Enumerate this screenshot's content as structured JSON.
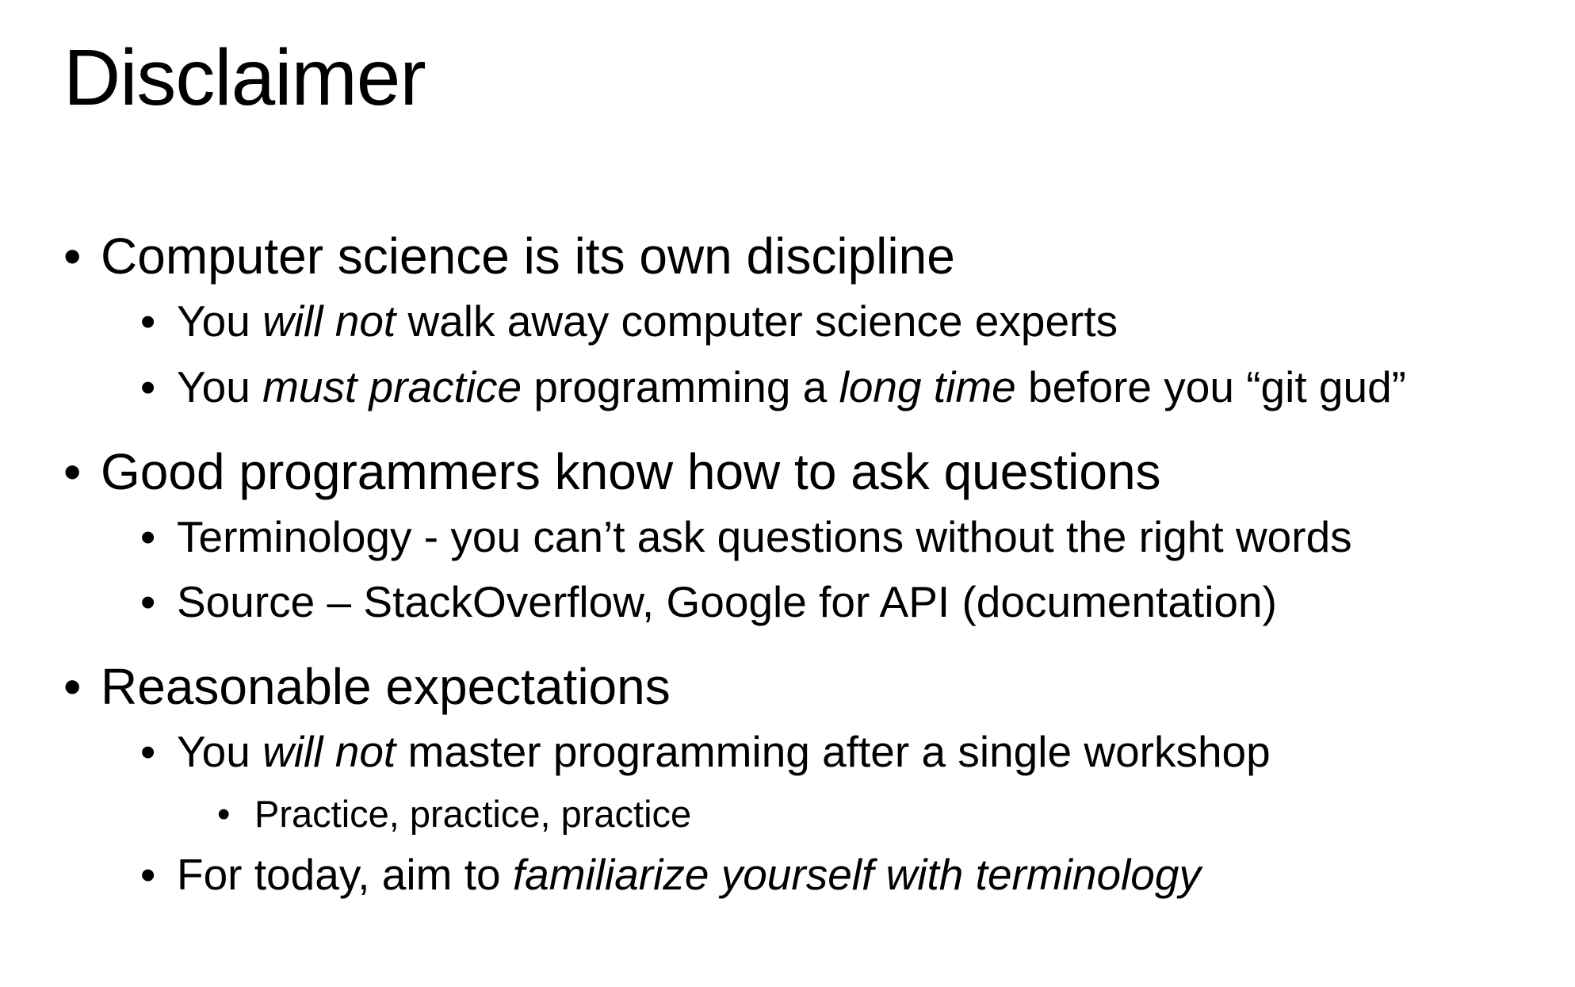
{
  "slide": {
    "title": "Disclaimer",
    "bullet_glyph": "•",
    "items": [
      {
        "level": 1,
        "segments": [
          {
            "text": "Computer science is its own discipline"
          }
        ]
      },
      {
        "level": 2,
        "segments": [
          {
            "text": "You "
          },
          {
            "text": "will not",
            "italic": true
          },
          {
            "text": " walk away computer science experts"
          }
        ]
      },
      {
        "level": 2,
        "segments": [
          {
            "text": "You "
          },
          {
            "text": "must practice",
            "italic": true
          },
          {
            "text": " programming a "
          },
          {
            "text": "long time",
            "italic": true
          },
          {
            "text": " before you “git gud”"
          }
        ]
      },
      {
        "level": 1,
        "segments": [
          {
            "text": "Good programmers know how to ask questions"
          }
        ]
      },
      {
        "level": 2,
        "segments": [
          {
            "text": "Terminology - you can’t ask questions without the right words"
          }
        ]
      },
      {
        "level": 2,
        "segments": [
          {
            "text": "Source – StackOverflow, Google for API (documentation)"
          }
        ]
      },
      {
        "level": 1,
        "segments": [
          {
            "text": "Reasonable expectations"
          }
        ]
      },
      {
        "level": 2,
        "segments": [
          {
            "text": "You "
          },
          {
            "text": "will not",
            "italic": true
          },
          {
            "text": " master programming after a single workshop"
          }
        ]
      },
      {
        "level": 3,
        "segments": [
          {
            "text": "Practice, practice, practice"
          }
        ]
      },
      {
        "level": 2,
        "segments": [
          {
            "text": "For today, aim to "
          },
          {
            "text": "familiarize yourself with terminology",
            "italic": true
          }
        ]
      }
    ]
  }
}
